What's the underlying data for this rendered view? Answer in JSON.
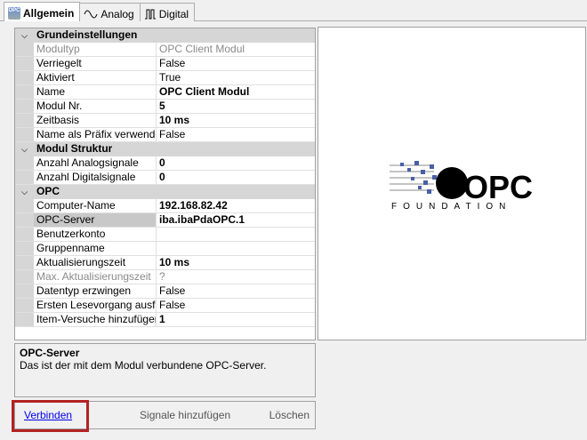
{
  "tabs": [
    {
      "label": "Allgemein",
      "icon": "opc-icon"
    },
    {
      "label": "Analog",
      "icon": "sine-wave-icon"
    },
    {
      "label": "Digital",
      "icon": "digital-pulse-icon"
    }
  ],
  "grid": {
    "rows": [
      {
        "type": "cat",
        "name": "Grundeinstellungen"
      },
      {
        "name": "Modultyp",
        "value": "OPC Client Modul",
        "style": "dis"
      },
      {
        "name": "Verriegelt",
        "value": "False"
      },
      {
        "name": "Aktiviert",
        "value": "True"
      },
      {
        "name": "Name",
        "value": "OPC Client Modul",
        "style": "bold"
      },
      {
        "name": "Modul Nr.",
        "value": "5",
        "style": "bold"
      },
      {
        "name": "Zeitbasis",
        "value": "10 ms",
        "style": "bold"
      },
      {
        "name": "Name als Präfix verwenden",
        "value": "False"
      },
      {
        "type": "cat",
        "name": "Modul Struktur"
      },
      {
        "name": "Anzahl Analogsignale",
        "value": "0",
        "style": "bold"
      },
      {
        "name": "Anzahl Digitalsignale",
        "value": "0",
        "style": "bold"
      },
      {
        "type": "cat",
        "name": "OPC"
      },
      {
        "name": "Computer-Name",
        "value": "192.168.82.42",
        "style": "bold"
      },
      {
        "name": "OPC-Server",
        "value": "iba.ibaPdaOPC.1",
        "style": "bold",
        "selected": true
      },
      {
        "name": "Benutzerkonto",
        "value": ""
      },
      {
        "name": "Gruppenname",
        "value": ""
      },
      {
        "name": "Aktualisierungszeit",
        "value": "10 ms",
        "style": "bold"
      },
      {
        "name": "Max. Aktualisierungszeit",
        "value": "?",
        "style": "dis"
      },
      {
        "name": "Datentyp erzwingen",
        "value": "False"
      },
      {
        "name": "Ersten Lesevorgang ausführen",
        "value": "False"
      },
      {
        "name": "Item-Versuche hinzufügen",
        "value": "1",
        "style": "bold"
      }
    ]
  },
  "logo": {
    "text": "OPC",
    "subtitle": "FOUNDATION"
  },
  "description": {
    "title": "OPC-Server",
    "text": "Das ist der mit dem Modul verbundene OPC-Server."
  },
  "buttons": {
    "connect": "Verbinden",
    "add_signals": "Signale hinzufügen",
    "delete": "Löschen"
  }
}
